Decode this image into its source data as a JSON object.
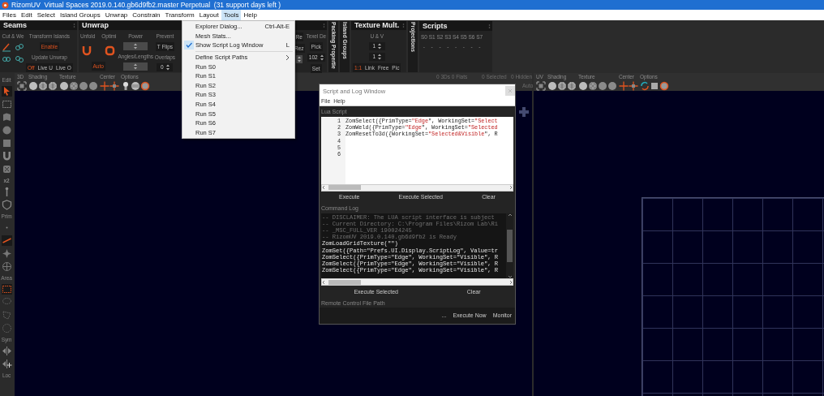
{
  "window": {
    "title": "RizomUV  Virtual Spaces 2019.0.140.gb6d9fb2.master Perpetual  (31 support days left )"
  },
  "menubar": [
    {
      "label": "Files",
      "selected": false
    },
    {
      "label": "Edit",
      "selected": false
    },
    {
      "label": "Select",
      "selected": false
    },
    {
      "label": "Island Groups",
      "selected": false
    },
    {
      "label": "Unwrap",
      "selected": false
    },
    {
      "label": "Constrain",
      "selected": false
    },
    {
      "label": "Transform",
      "selected": false
    },
    {
      "label": "Layout",
      "selected": false
    },
    {
      "label": "Tools",
      "selected": true
    },
    {
      "label": "Help",
      "selected": false
    }
  ],
  "ribbon": [
    {
      "kind": "panel",
      "title": "Seams",
      "columns": [
        [
          {
            "kind": "label",
            "text": "Cut & We"
          },
          {
            "kind": "cut-icons"
          },
          {
            "kind": "weld-icons"
          }
        ],
        [
          {
            "kind": "label",
            "text": "Transform Islands"
          },
          {
            "kind": "button",
            "text": "Enable",
            "accent": true
          },
          {
            "kind": "label",
            "text": "Update Unwrap"
          },
          {
            "kind": "buttons",
            "items": [
              {
                "text": "Off",
                "accent": true
              },
              {
                "text": "Live U",
                "accent": false
              },
              {
                "text": "Live O",
                "accent": false
              }
            ]
          }
        ]
      ]
    },
    {
      "kind": "panel",
      "title": "Unwrap",
      "columns": [
        [
          {
            "kind": "labels",
            "items": [
              "Unfold",
              "Optimi"
            ]
          },
          {
            "kind": "unfold-icons"
          },
          {
            "kind": "button",
            "text": "Auto",
            "accent": true
          }
        ],
        [
          {
            "kind": "label",
            "text": "Power"
          },
          {
            "kind": "spin"
          },
          {
            "kind": "label",
            "text": "Angles/Lengths"
          },
          {
            "kind": "spin"
          }
        ],
        [
          {
            "kind": "label",
            "text": "Prevent"
          },
          {
            "kind": "button",
            "text": "T Flips",
            "accent": false
          },
          {
            "kind": "label",
            "text": "Overlaps"
          },
          {
            "kind": "spin",
            "text": "0"
          }
        ],
        [
          {
            "kind": "button",
            "text": "Re",
            "accent": false
          },
          {
            "kind": "button",
            "text": "Rez",
            "accent": false
          },
          {
            "kind": "spin"
          }
        ],
        [
          {
            "kind": "label",
            "text": "Texel De"
          },
          {
            "kind": "button",
            "text": "Pick",
            "accent": false
          },
          {
            "kind": "spin",
            "text": "102"
          },
          {
            "kind": "button",
            "text": "Set",
            "accent": false
          }
        ]
      ]
    },
    {
      "kind": "vtab",
      "title": "Packing Propertie"
    },
    {
      "kind": "vtab",
      "title": "Island Groups"
    },
    {
      "kind": "panel",
      "title": "Texture Mult.",
      "columns": [
        [
          {
            "kind": "label",
            "text": "U & V"
          },
          {
            "kind": "spin",
            "text": "1"
          },
          {
            "kind": "spin",
            "text": "1"
          },
          {
            "kind": "buttons",
            "items": [
              {
                "text": "1:1",
                "accent": true
              },
              {
                "text": "Link",
                "accent": false
              },
              {
                "text": "Free",
                "accent": false
              },
              {
                "text": "Pic",
                "accent": false
              }
            ]
          }
        ]
      ]
    },
    {
      "kind": "vtab",
      "title": "Projections"
    },
    {
      "kind": "panel",
      "title": "Scripts",
      "columns": [
        [
          {
            "kind": "label",
            "text": "S0"
          },
          {
            "kind": "label",
            "text": "-"
          }
        ],
        [
          {
            "kind": "label",
            "text": "S1"
          },
          {
            "kind": "label",
            "text": "-"
          }
        ],
        [
          {
            "kind": "label",
            "text": "S2"
          },
          {
            "kind": "label",
            "text": "-"
          }
        ],
        [
          {
            "kind": "label",
            "text": "S3"
          },
          {
            "kind": "label",
            "text": "-"
          }
        ],
        [
          {
            "kind": "label",
            "text": "S4"
          },
          {
            "kind": "label",
            "text": "-"
          }
        ],
        [
          {
            "kind": "label",
            "text": "S5"
          },
          {
            "kind": "label",
            "text": "-"
          }
        ],
        [
          {
            "kind": "label",
            "text": "S6"
          },
          {
            "kind": "label",
            "text": "-"
          }
        ],
        [
          {
            "kind": "label",
            "text": "S7"
          },
          {
            "kind": "label",
            "text": "-"
          }
        ]
      ]
    }
  ],
  "left_toolbar": [
    {
      "kind": "label",
      "text": "Edit"
    },
    {
      "kind": "tool",
      "selected": true
    },
    {
      "kind": "tool",
      "selected": false
    },
    {
      "kind": "tool",
      "selected": false
    },
    {
      "kind": "tool",
      "selected": false
    },
    {
      "kind": "tool",
      "selected": false
    },
    {
      "kind": "tool",
      "selected": false
    },
    {
      "kind": "tool",
      "selected": false
    },
    {
      "kind": "text",
      "text": "x2"
    },
    {
      "kind": "tool",
      "selected": false
    },
    {
      "kind": "tool",
      "selected": false
    },
    {
      "kind": "label",
      "text": "Prim"
    },
    {
      "kind": "tool",
      "selected": false
    },
    {
      "kind": "tool",
      "selected": true
    },
    {
      "kind": "tool",
      "selected": false
    },
    {
      "kind": "tool",
      "selected": false
    },
    {
      "kind": "label",
      "text": "Area"
    },
    {
      "kind": "tool",
      "selected": true
    },
    {
      "kind": "tool",
      "selected": false
    },
    {
      "kind": "tool",
      "selected": false
    },
    {
      "kind": "tool",
      "selected": false
    },
    {
      "kind": "label",
      "text": "Sym"
    },
    {
      "kind": "tool",
      "selected": false
    },
    {
      "kind": "tool",
      "selected": false
    },
    {
      "kind": "label",
      "text": "Loc"
    }
  ],
  "viewports": [
    {
      "label": "3D",
      "groups": [
        "Shading",
        "Texture",
        "Center",
        "Options"
      ],
      "status": [
        "0 3Ds 0 Flats",
        "0 Selected",
        "0 Hidden"
      ],
      "auto": "Auto"
    },
    {
      "label": "UV",
      "groups": [
        "Shading",
        "Texture",
        "Center",
        "Options"
      ]
    }
  ],
  "tools_menu": [
    {
      "kind": "item",
      "label": "Explorer Dialog...",
      "shortcut": "Ctrl-Alt-E",
      "checked": false
    },
    {
      "kind": "item",
      "label": "Mesh Stats...",
      "checked": false
    },
    {
      "kind": "item",
      "label": "Show Script Log Window",
      "shortcut": "L",
      "checked": true
    },
    {
      "kind": "separator"
    },
    {
      "kind": "item",
      "label": "Define Script Paths",
      "submenu": true,
      "checked": false
    },
    {
      "kind": "item",
      "label": "Run S0",
      "checked": false
    },
    {
      "kind": "item",
      "label": "Run S1",
      "checked": false
    },
    {
      "kind": "item",
      "label": "Run S2",
      "checked": false
    },
    {
      "kind": "item",
      "label": "Run S3",
      "checked": false
    },
    {
      "kind": "item",
      "label": "Run S4",
      "checked": false
    },
    {
      "kind": "item",
      "label": "Run S5",
      "checked": false
    },
    {
      "kind": "item",
      "label": "Run S6",
      "checked": false
    },
    {
      "kind": "item",
      "label": "Run S7",
      "checked": false
    }
  ],
  "script_window": {
    "title": "Script and Log Window",
    "menu": [
      "File",
      "Help"
    ],
    "script_label": "Lua Script",
    "code": [
      {
        "number": "1",
        "text": "ZomSelect({PrimType=\"Edge\", WorkingSet=\"Select"
      },
      {
        "number": "2",
        "text": "ZomWeld({PrimType=\"Edge\", WorkingSet=\"Selected"
      },
      {
        "number": "3",
        "text": "ZomResetTo3d({WorkingSet=\"Selected&Visible\", R"
      },
      {
        "number": "4"
      },
      {
        "number": "5"
      },
      {
        "number": "6"
      }
    ],
    "script_buttons": [
      "Execute",
      "Execute Selected",
      "Clear"
    ],
    "log_label": "Command Log",
    "log": [
      {
        "kind": "comment",
        "text": "-- DISCLAIMER: The LUA script interface is subject"
      },
      {
        "kind": "comment",
        "text": "-- Current Directory: C:\\Program Files\\Rizom Lab\\Ri"
      },
      {
        "kind": "comment",
        "text": "-- _MSC_FULL_VER 190024245"
      },
      {
        "kind": "comment",
        "text": "-- RizomUV 2019.0.140.gb6d9fb2 is Ready"
      },
      {
        "kind": "command",
        "text": "ZomLoadGridTexture(\"\")"
      },
      {
        "kind": "command",
        "text": "ZomSet({Path=\"Prefs.UI.Display.ScriptLog\", Value=tr"
      },
      {
        "kind": "command",
        "text": "ZomSelect({PrimType=\"Edge\", WorkingSet=\"Visible\", R"
      },
      {
        "kind": "command",
        "text": "ZomSelect({PrimType=\"Edge\", WorkingSet=\"Visible\", R"
      },
      {
        "kind": "command",
        "text": "ZomSelect({PrimType=\"Edge\", WorkingSet=\"Visible\", R"
      }
    ],
    "log_buttons": [
      "Execute Selected",
      "Clear"
    ],
    "remote_label": "Remote Control File Path",
    "remote_buttons": [
      "...",
      "Execute Now",
      "Monitor"
    ]
  }
}
